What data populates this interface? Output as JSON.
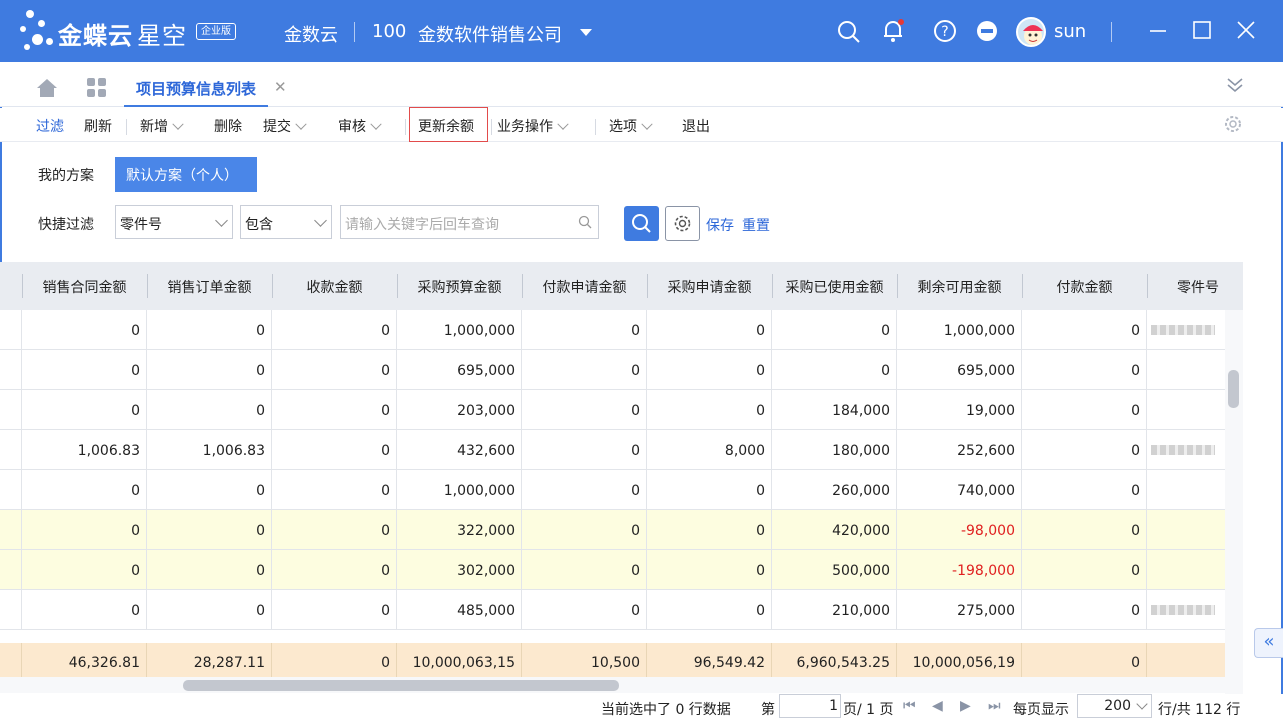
{
  "app": {
    "brand": "金蝶云",
    "brand_sub": "星空",
    "edition": "企业版",
    "cloud": "金数云",
    "org_code": "100",
    "org_name": "金数软件销售公司",
    "user": "sun",
    "accent": "#3f7be0"
  },
  "tabs": {
    "active_label": "项目预算信息列表"
  },
  "toolbar": {
    "filter": "过滤",
    "refresh": "刷新",
    "add": "新增",
    "delete": "删除",
    "submit": "提交",
    "audit": "审核",
    "update_balance": "更新余额",
    "business_ops": "业务操作",
    "options": "选项",
    "exit": "退出"
  },
  "plan": {
    "label": "我的方案",
    "default": "默认方案（个人）"
  },
  "quick_filter": {
    "label": "快捷过滤",
    "field": "零件号",
    "operator": "包含",
    "placeholder": "请输入关键字后回车查询",
    "save": "保存",
    "reset": "重置"
  },
  "table": {
    "columns": [
      "销售合同金额",
      "销售订单金额",
      "收款金额",
      "采购预算金额",
      "付款申请金额",
      "采购申请金额",
      "采购已使用金额",
      "剩余可用金额",
      "付款金额",
      "零件号"
    ],
    "rows": [
      {
        "cells": [
          "0",
          "0",
          "0",
          "1,000,000",
          "0",
          "0",
          "0",
          "1,000,000",
          "0"
        ],
        "part_masked": true,
        "highlight": false,
        "negative": false
      },
      {
        "cells": [
          "0",
          "0",
          "0",
          "695,000",
          "0",
          "0",
          "0",
          "695,000",
          "0"
        ],
        "part_masked": false,
        "highlight": false,
        "negative": false
      },
      {
        "cells": [
          "0",
          "0",
          "0",
          "203,000",
          "0",
          "0",
          "184,000",
          "19,000",
          "0"
        ],
        "part_masked": false,
        "highlight": false,
        "negative": false
      },
      {
        "cells": [
          "1,006.83",
          "1,006.83",
          "0",
          "432,600",
          "0",
          "8,000",
          "180,000",
          "252,600",
          "0"
        ],
        "part_masked": true,
        "highlight": false,
        "negative": false
      },
      {
        "cells": [
          "0",
          "0",
          "0",
          "1,000,000",
          "0",
          "0",
          "260,000",
          "740,000",
          "0"
        ],
        "part_masked": false,
        "highlight": false,
        "negative": false
      },
      {
        "cells": [
          "0",
          "0",
          "0",
          "322,000",
          "0",
          "0",
          "420,000",
          "-98,000",
          "0"
        ],
        "part_masked": false,
        "highlight": true,
        "negative": true
      },
      {
        "cells": [
          "0",
          "0",
          "0",
          "302,000",
          "0",
          "0",
          "500,000",
          "-198,000",
          "0"
        ],
        "part_masked": false,
        "highlight": true,
        "negative": true
      },
      {
        "cells": [
          "0",
          "0",
          "0",
          "485,000",
          "0",
          "0",
          "210,000",
          "275,000",
          "0"
        ],
        "part_masked": true,
        "highlight": false,
        "negative": false
      }
    ],
    "totals": [
      "46,326.81",
      "28,287.11",
      "0",
      "10,000,063,15",
      "10,500",
      "96,549.42",
      "6,960,543.25",
      "10,000,056,19",
      "0"
    ]
  },
  "footer": {
    "selected": "当前选中了 0 行数据",
    "page_prefix": "第",
    "page": "1",
    "page_suffix": "页/ 1 页",
    "per_page_label": "每页显示",
    "per_page": "200",
    "total": "行/共 112 行"
  }
}
